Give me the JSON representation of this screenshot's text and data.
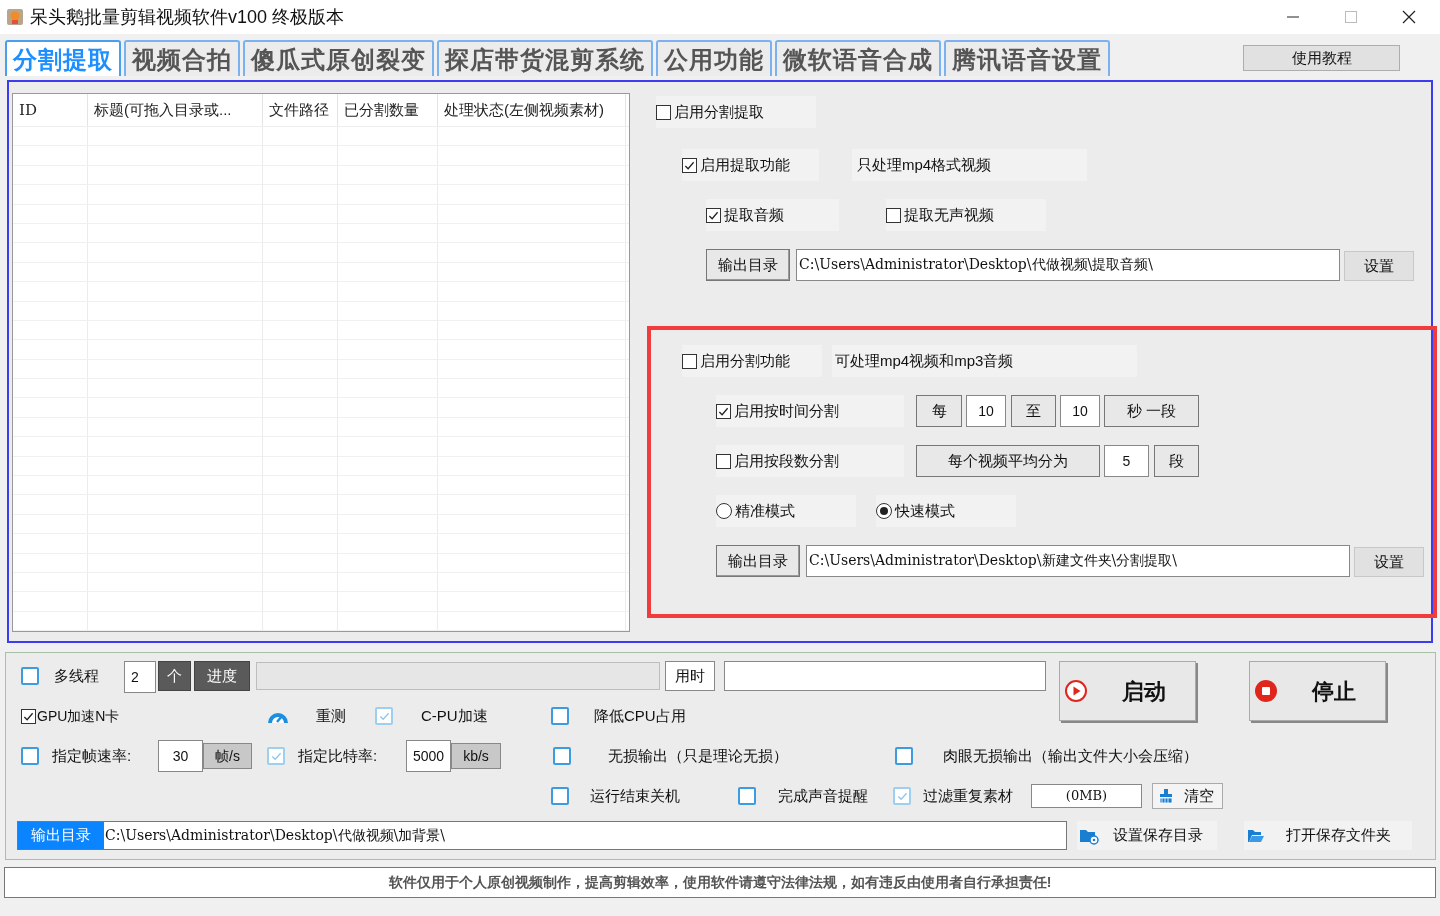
{
  "window": {
    "title": "呆头鹅批量剪辑视频软件v100 终极版本"
  },
  "tabs": [
    {
      "label": "分割提取",
      "selected": true
    },
    {
      "label": "视频合拍",
      "selected": false
    },
    {
      "label": "傻瓜式原创裂变",
      "selected": false
    },
    {
      "label": "探店带货混剪系统",
      "selected": false
    },
    {
      "label": "公用功能",
      "selected": false
    },
    {
      "label": "微软语音合成",
      "selected": false
    },
    {
      "label": "腾讯语音设置",
      "selected": false
    }
  ],
  "help_button": "使用教程",
  "file_table": {
    "columns": [
      "ID",
      "标题(可拖入目录或...",
      "文件路径",
      "已分割数量",
      "处理状态(左侧视频素材)"
    ]
  },
  "extract": {
    "enable_split_extract": {
      "label": "启用分割提取",
      "checked": false
    },
    "enable_extract": {
      "label": "启用提取功能",
      "checked": true
    },
    "note": "只处理mp4格式视频",
    "extract_audio": {
      "label": "提取音频",
      "checked": true
    },
    "extract_silent_video": {
      "label": "提取无声视频",
      "checked": false
    },
    "output_button": "输出目录",
    "output_path": "C:\\Users\\Administrator\\Desktop\\代做视频\\提取音频\\",
    "set_button": "设置"
  },
  "split": {
    "enable_split": {
      "label": "启用分割功能",
      "checked": false
    },
    "note": "可处理mp4视频和mp3音频",
    "by_time": {
      "label": "启用按时间分割",
      "checked": true,
      "every": "每",
      "from": "10",
      "to_label": "至",
      "to": "10",
      "unit": "秒 一段"
    },
    "by_count": {
      "label": "启用按段数分割",
      "checked": false,
      "prefix": "每个视频平均分为",
      "count": "5",
      "unit": "段"
    },
    "modes": [
      {
        "label": "精准模式",
        "selected": false
      },
      {
        "label": "快速模式",
        "selected": true
      }
    ],
    "output_button": "输出目录",
    "output_path": "C:\\Users\\Administrator\\Desktop\\新建文件夹\\分割提取\\",
    "set_button": "设置"
  },
  "bottom": {
    "multithread": {
      "label": "多线程",
      "checked": false
    },
    "threads": "2",
    "threads_unit": "个",
    "progress_label": "进度",
    "progress": {
      "level": 0
    },
    "time_label": "用时",
    "start_button": "启动",
    "stop_button": "停止",
    "gpu": {
      "label": "GPU加速N卡",
      "checked": true
    },
    "retest": "重测",
    "cpu_accel": {
      "label": "C-PU加速",
      "checked": true
    },
    "low_cpu": {
      "label": "降低CPU占用",
      "checked": false
    },
    "framerate": {
      "label": "指定帧速率:",
      "checked": false,
      "value": "30",
      "unit": "帧/s"
    },
    "bitrate": {
      "label": "指定比特率:",
      "checked": true,
      "value": "5000",
      "unit": "kb/s"
    },
    "lossless": {
      "label": "无损输出（只是理论无损）",
      "checked": false
    },
    "visual_lossless": {
      "label": "肉眼无损输出（输出文件大小会压缩）",
      "checked": false
    },
    "shutdown": {
      "label": "运行结束关机",
      "checked": false
    },
    "sound_alert": {
      "label": "完成声音提醒",
      "checked": false
    },
    "filter_duplicates": {
      "label": "过滤重复素材",
      "checked": true
    },
    "cache_size": "(0MB)",
    "clear_button": "清空",
    "output_label": "输出目录",
    "output_path": "C:\\Users\\Administrator\\Desktop\\代做视频\\加背景\\",
    "set_save_dir": "设置保存目录",
    "open_save_folder": "打开保存文件夹"
  },
  "footer": "软件仅用于个人原创视频制作，提高剪辑效率，使用软件请遵守法律法规，如有违反由使用者自行承担责任!"
}
